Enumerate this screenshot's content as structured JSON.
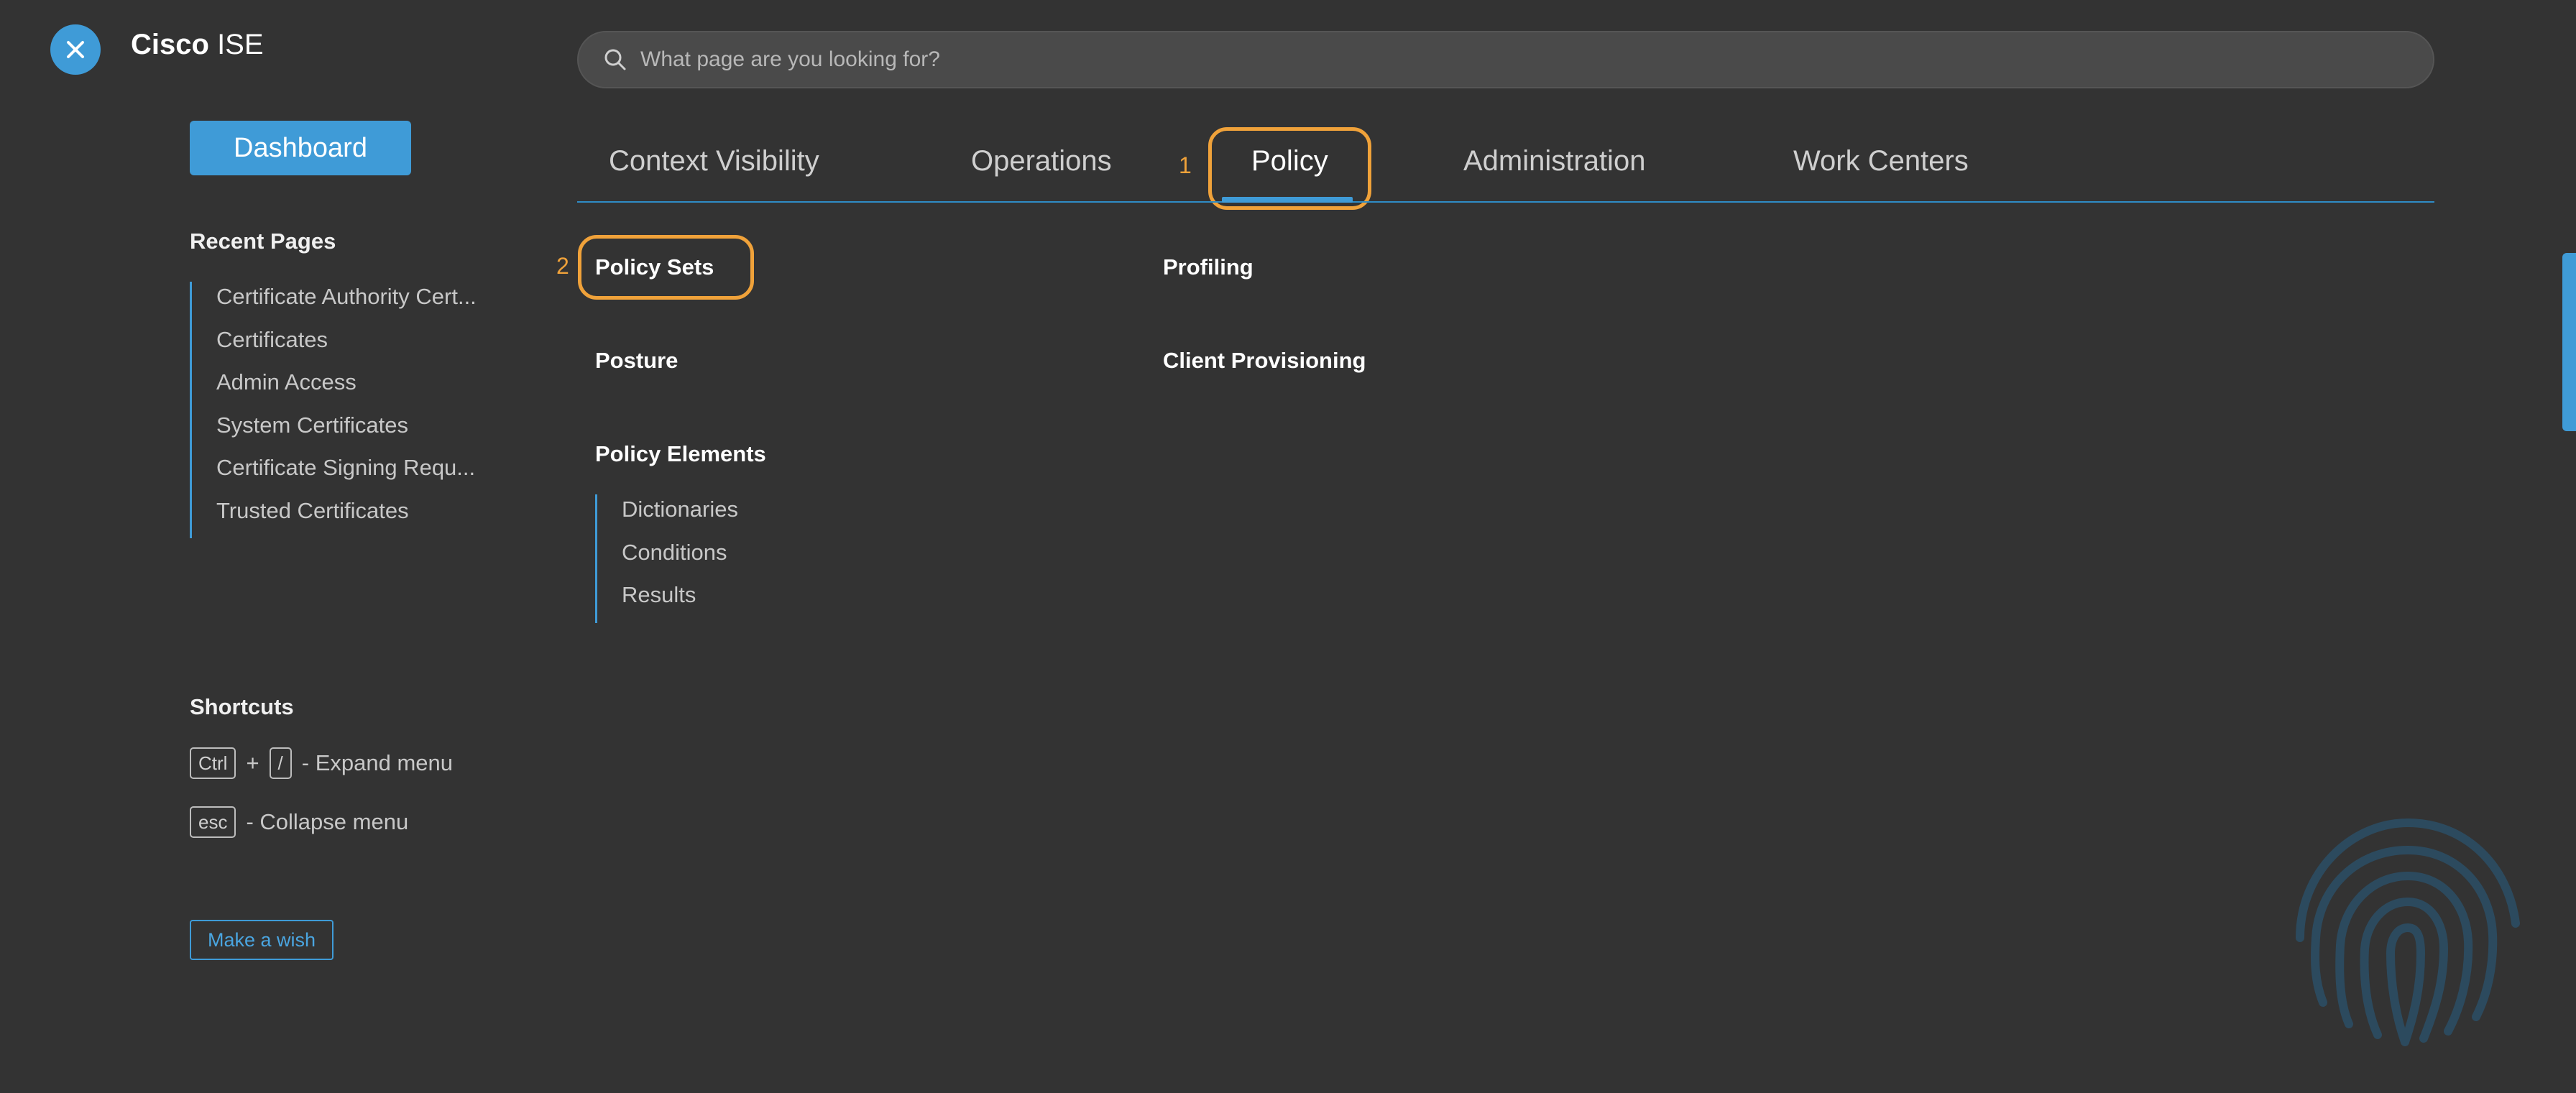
{
  "header": {
    "brand_bold": "Cisco",
    "brand_light": "ISE",
    "search_placeholder": "What page are you looking for?"
  },
  "sidebar": {
    "dashboard_label": "Dashboard",
    "recent_heading": "Recent Pages",
    "recent_pages": [
      "Certificate Authority Cert...",
      "Certificates",
      "Admin Access",
      "System Certificates",
      "Certificate Signing Requ...",
      "Trusted Certificates"
    ],
    "shortcuts_heading": "Shortcuts",
    "shortcuts": {
      "ctrl_key": "Ctrl",
      "plus": "+",
      "slash_key": "/",
      "expand_text": "- Expand menu",
      "esc_key": "esc",
      "collapse_text": "- Collapse menu"
    },
    "wish_label": "Make a wish"
  },
  "tabs": [
    "Context Visibility",
    "Operations",
    "Policy",
    "Administration",
    "Work Centers"
  ],
  "active_tab": "Policy",
  "annotations": {
    "step1": "1",
    "step2": "2"
  },
  "policy_menu": {
    "col1": {
      "policy_sets": "Policy Sets",
      "posture": "Posture",
      "policy_elements": "Policy Elements",
      "policy_elements_items": [
        "Dictionaries",
        "Conditions",
        "Results"
      ]
    },
    "col2": {
      "profiling": "Profiling",
      "client_provisioning": "Client Provisioning"
    }
  },
  "colors": {
    "background": "#333333",
    "accent": "#3f9bd7",
    "highlight": "#f0a23a"
  },
  "icons": {
    "close": "close-icon",
    "search": "search-icon",
    "fingerprint": "fingerprint-icon"
  }
}
